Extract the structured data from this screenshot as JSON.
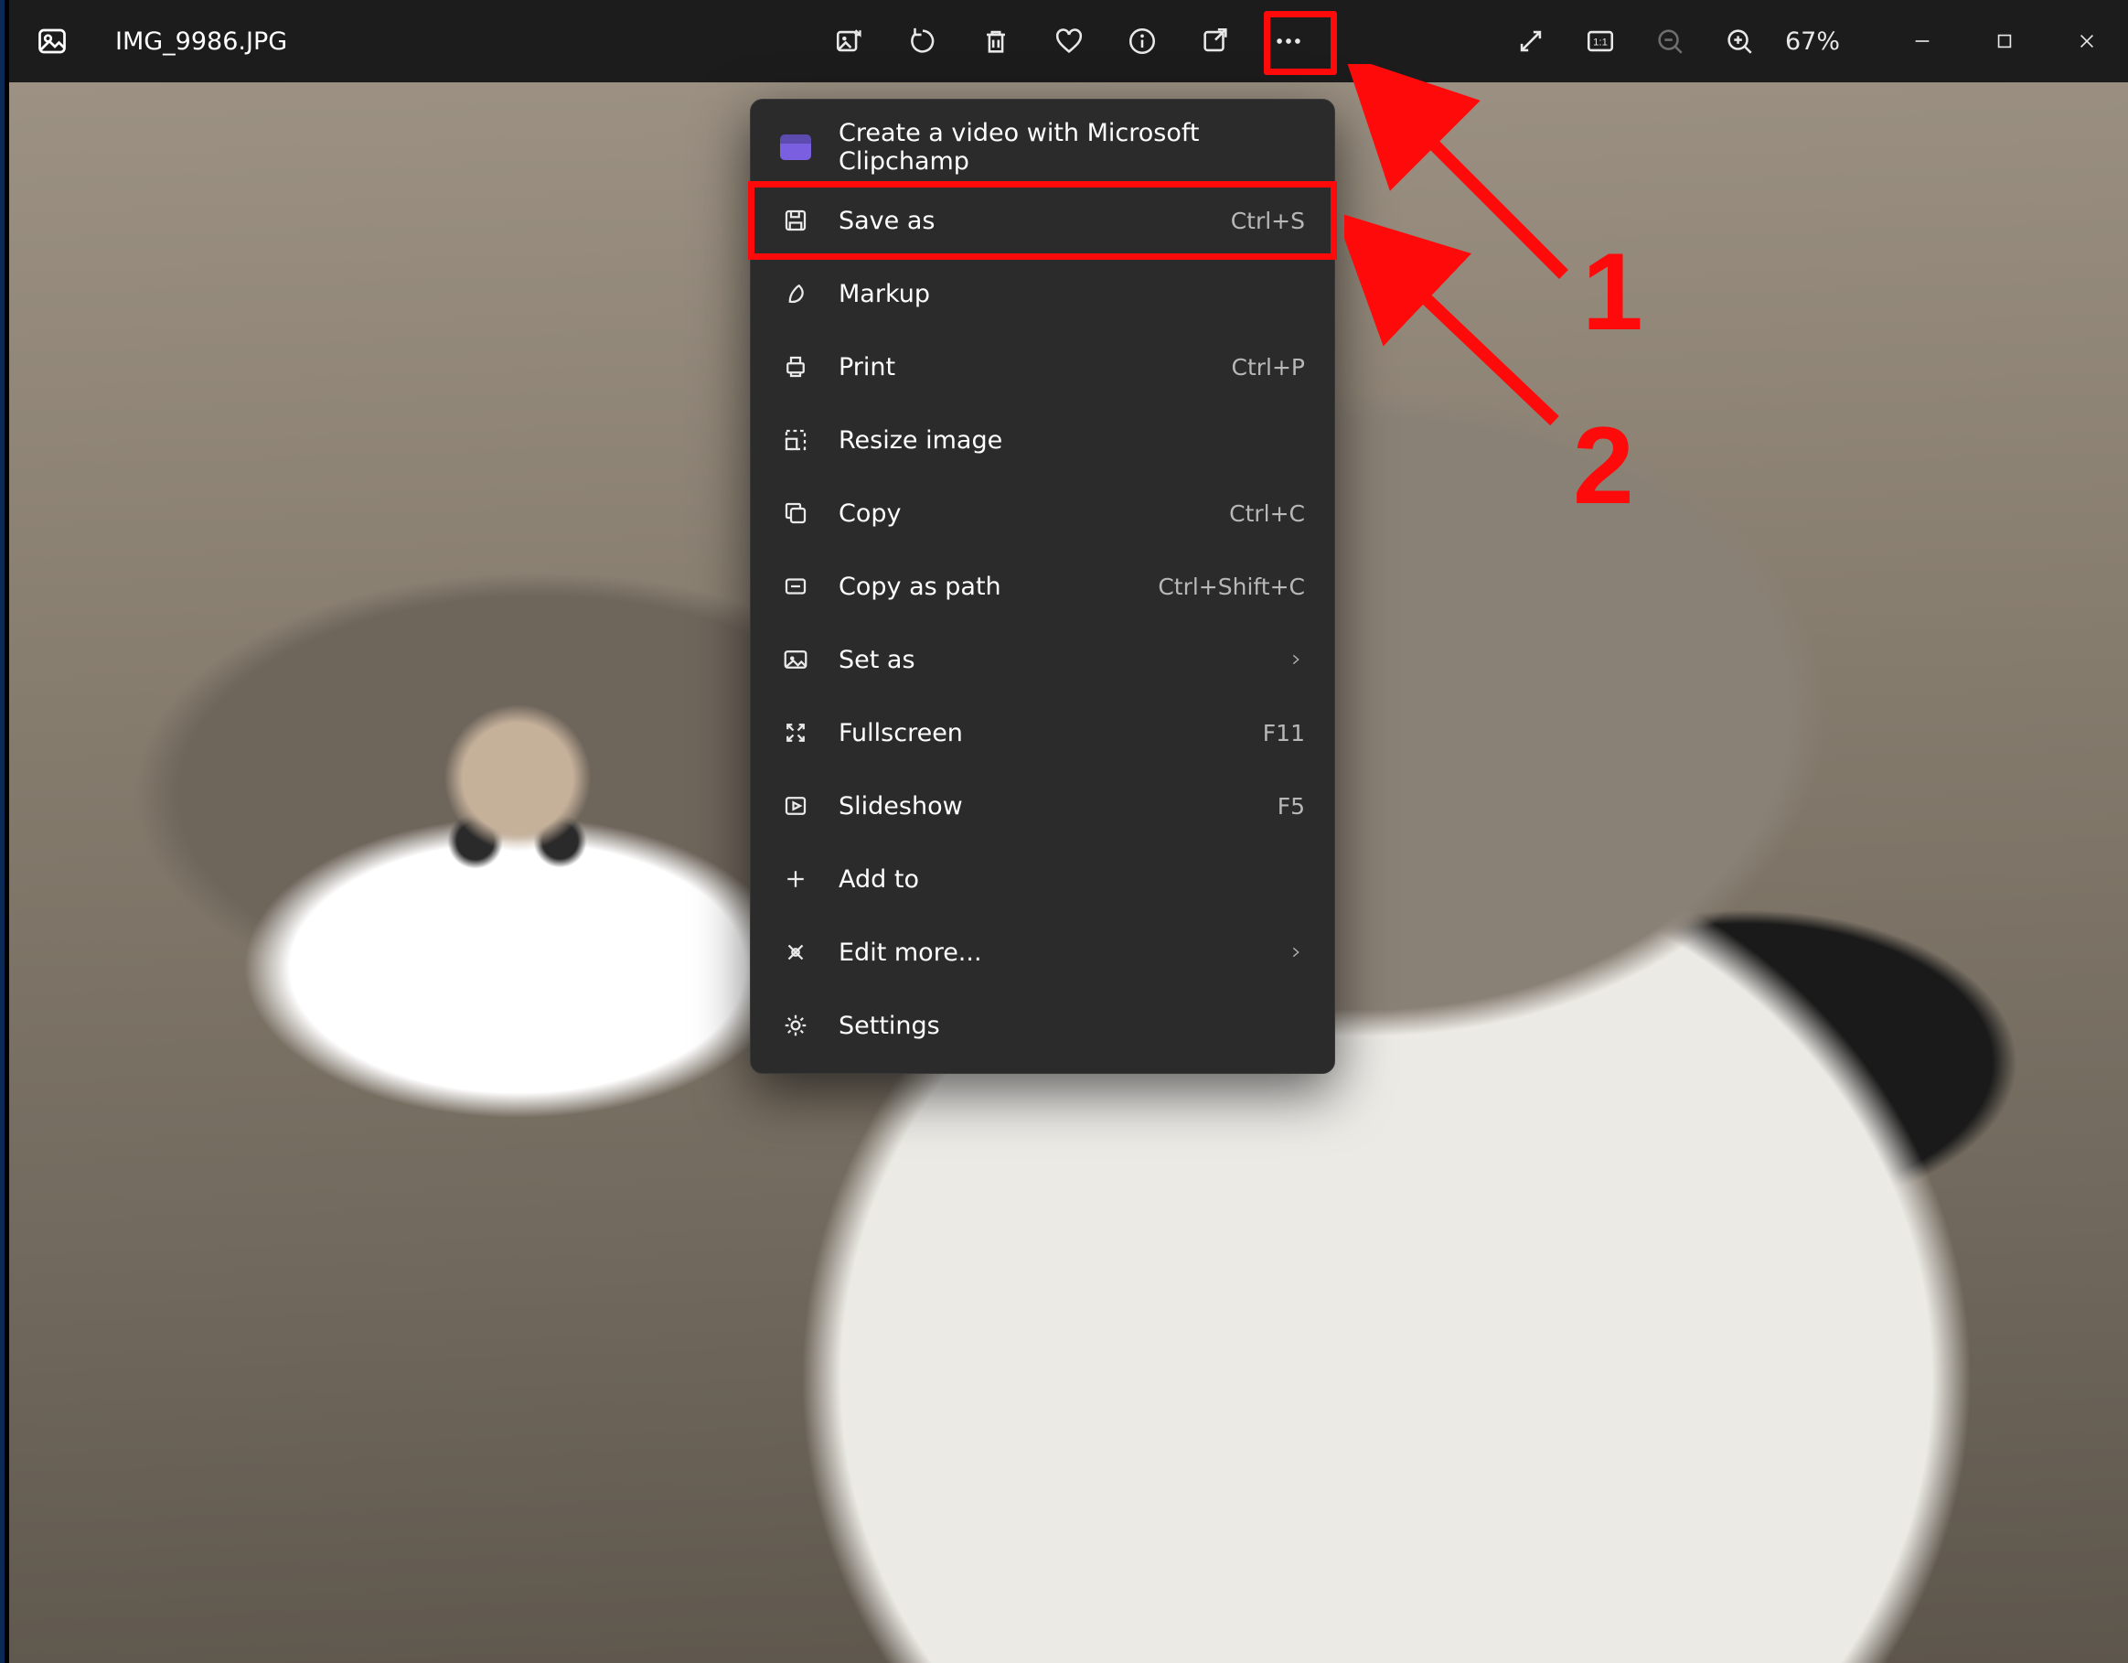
{
  "titlebar": {
    "filename": "IMG_9986.JPG",
    "zoom": "67%"
  },
  "menu": {
    "items": [
      {
        "label": "Create a video with Microsoft Clipchamp",
        "short": "",
        "icon": "clipchamp",
        "chevron": false,
        "highlight": false
      },
      {
        "label": "Save as",
        "short": "Ctrl+S",
        "icon": "save",
        "chevron": false,
        "highlight": true
      },
      {
        "label": "Markup",
        "short": "",
        "icon": "markup",
        "chevron": false,
        "highlight": false
      },
      {
        "label": "Print",
        "short": "Ctrl+P",
        "icon": "print",
        "chevron": false,
        "highlight": false
      },
      {
        "label": "Resize image",
        "short": "",
        "icon": "resize",
        "chevron": false,
        "highlight": false
      },
      {
        "label": "Copy",
        "short": "Ctrl+C",
        "icon": "copy",
        "chevron": false,
        "highlight": false
      },
      {
        "label": "Copy as path",
        "short": "Ctrl+Shift+C",
        "icon": "copypath",
        "chevron": false,
        "highlight": false
      },
      {
        "label": "Set as",
        "short": "",
        "icon": "setas",
        "chevron": true,
        "highlight": false
      },
      {
        "label": "Fullscreen",
        "short": "F11",
        "icon": "fullscreen",
        "chevron": false,
        "highlight": false
      },
      {
        "label": "Slideshow",
        "short": "F5",
        "icon": "slideshow",
        "chevron": false,
        "highlight": false
      },
      {
        "label": "Add to",
        "short": "",
        "icon": "add",
        "chevron": false,
        "highlight": false
      },
      {
        "label": "Edit more...",
        "short": "",
        "icon": "editmore",
        "chevron": true,
        "highlight": false
      },
      {
        "label": "Settings",
        "short": "",
        "icon": "settings",
        "chevron": false,
        "highlight": false
      }
    ]
  },
  "annotations": {
    "one": "1",
    "two": "2"
  }
}
